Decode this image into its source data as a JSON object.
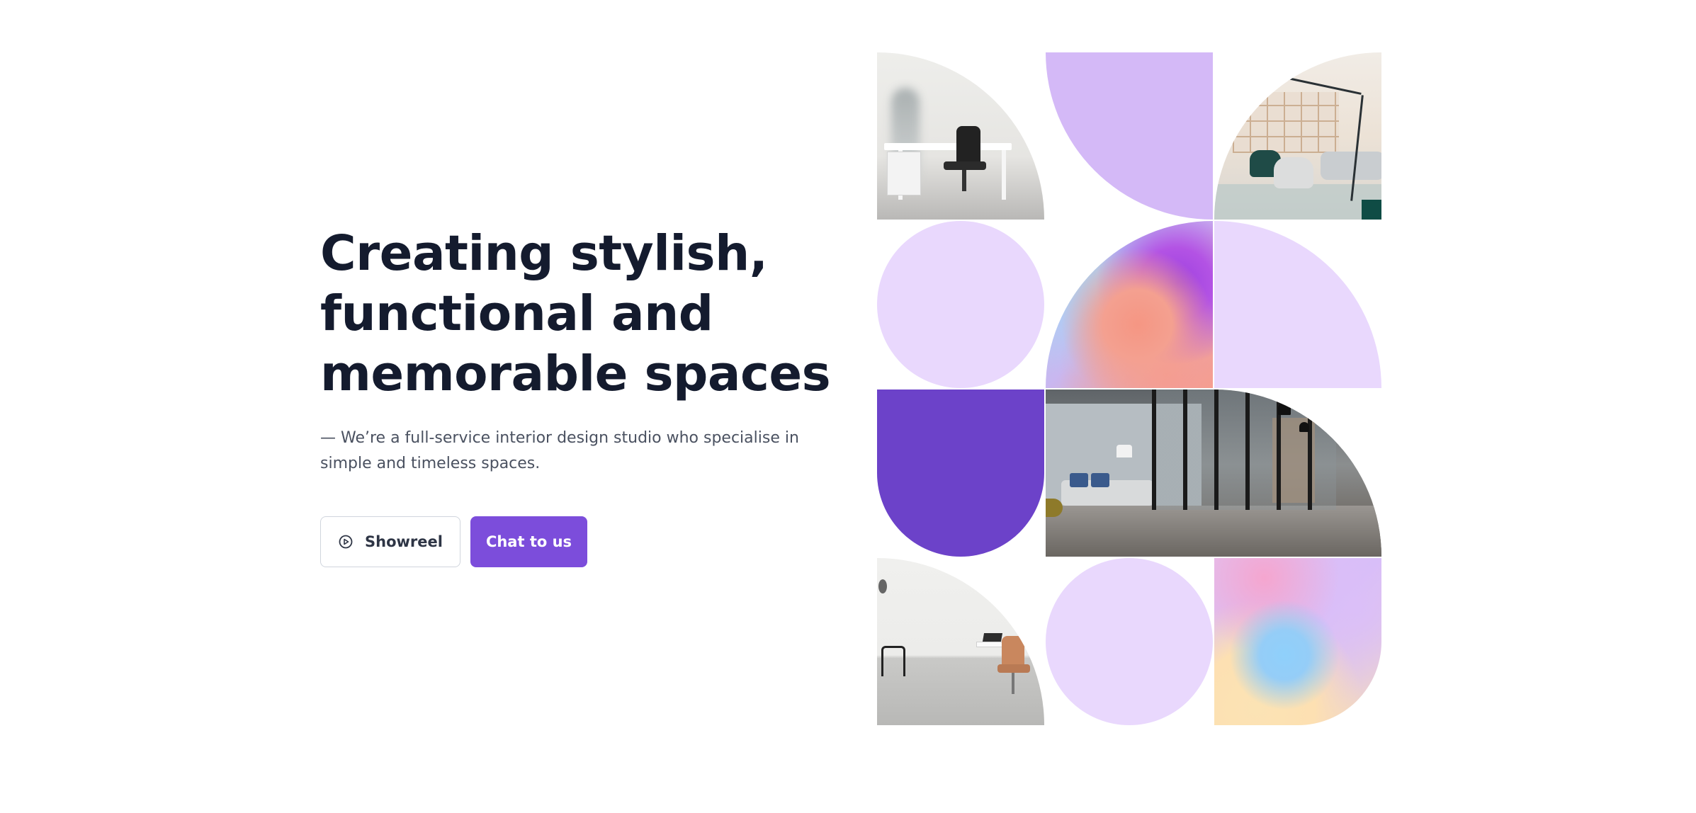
{
  "hero": {
    "headline_lines": [
      "Creating stylish,",
      "functional and",
      "memorable spaces"
    ],
    "subtext": "— We’re a full-service interior design studio who specialise in simple and timeless spaces.",
    "buttons": {
      "showreel_label": "Showreel",
      "showreel_icon": "play-circle-icon",
      "chat_label": "Chat to us"
    }
  },
  "colors": {
    "accent": "#7c4ddb",
    "heading": "#141b2e",
    "body_text": "#4a5160",
    "lavender": "#d4b9f7",
    "lavender_light": "#e9d8fd",
    "deep_purple": "#6c42c9"
  },
  "gallery": {
    "tiles": [
      "office-photo",
      "lavender-leaf",
      "lounge-photo",
      "lavender-circle",
      "gradient-blob",
      "lavender-leaf",
      "purple-arch",
      "corridor-photo",
      "white-office-photo",
      "lavender-circle",
      "gradient-blob"
    ]
  }
}
